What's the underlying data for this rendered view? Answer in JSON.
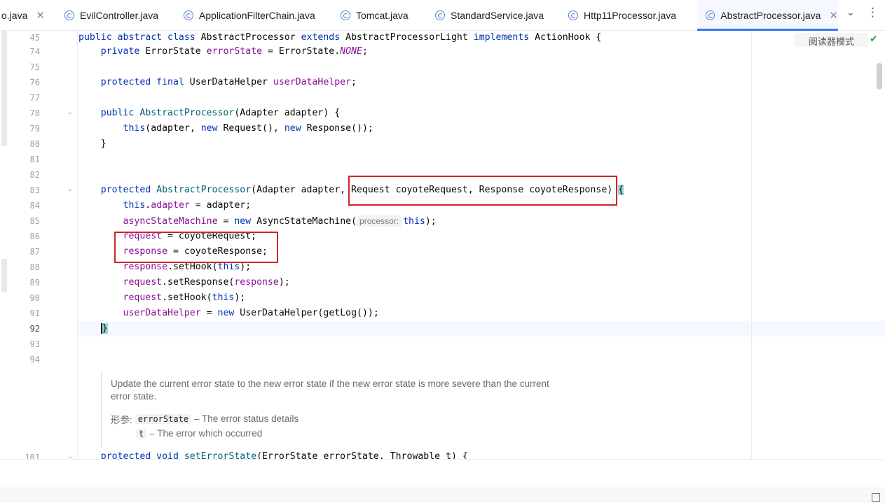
{
  "tabs": [
    {
      "label": "o.java",
      "active": false,
      "has_icon": false,
      "closable": true
    },
    {
      "label": "EvilController.java",
      "active": false,
      "has_icon": true
    },
    {
      "label": "ApplicationFilterChain.java",
      "active": false,
      "has_icon": true
    },
    {
      "label": "Tomcat.java",
      "active": false,
      "has_icon": true
    },
    {
      "label": "StandardService.java",
      "active": false,
      "has_icon": true
    },
    {
      "label": "Http11Processor.java",
      "active": false,
      "has_icon": true
    },
    {
      "label": "AbstractProcessor.java",
      "active": true,
      "has_icon": true,
      "closable": true
    }
  ],
  "toolbar": {
    "reader_mode": "阅读器模式",
    "tab_list_glyph": "⌄",
    "menu_glyph": "⋮",
    "close_glyph": "✕",
    "check_glyph": "✔"
  },
  "gutter": {
    "line_numbers": [
      "45",
      "74",
      "75",
      "76",
      "77",
      "78",
      "79",
      "80",
      "81",
      "82",
      "83",
      "84",
      "85",
      "86",
      "87",
      "88",
      "89",
      "90",
      "91",
      "92",
      "93",
      "94",
      "101"
    ],
    "current_line": "92",
    "fold_glyph": "⌄"
  },
  "code": {
    "l45": {
      "t1": "public abstract class ",
      "t2": "AbstractProcessor ",
      "t3": "extends ",
      "t4": "AbstractProcessorLight ",
      "t5": "implements ",
      "t6": "ActionHook {"
    },
    "l74": {
      "t1": "    private ",
      "t2": "ErrorState ",
      "t3": "errorState",
      "t4": " = ErrorState.",
      "t5": "NONE",
      "t6": ";"
    },
    "l76": {
      "t1": "    protected final ",
      "t2": "UserDataHelper ",
      "t3": "userDataHelper",
      "t4": ";"
    },
    "l78": {
      "t1": "    public ",
      "t2": "AbstractProcessor",
      "t3": "(Adapter adapter) {"
    },
    "l79": {
      "t1": "        ",
      "t2": "this",
      "t3": "(adapter, ",
      "t4": "new ",
      "t5": "Request(), ",
      "t6": "new ",
      "t7": "Response());"
    },
    "l80": {
      "t1": "    }"
    },
    "l83": {
      "t1": "    protected ",
      "t2": "AbstractProcessor",
      "t3": "(Adapter adapter, Request coyoteRequest, Response coyoteResponse) ",
      "t4": "{"
    },
    "l84": {
      "t1": "        ",
      "t2": "this",
      "t3": ".",
      "t4": "adapter",
      "t5": " = adapter;"
    },
    "l85": {
      "t1": "        ",
      "t2": "asyncStateMachine",
      "t3": " = ",
      "t4": "new ",
      "t5": "AsyncStateMachine(",
      "hint": "processor:",
      "t6": "this",
      "t7": ");"
    },
    "l86": {
      "t1": "        ",
      "t2": "request",
      "t3": " = coyoteRequest;"
    },
    "l87": {
      "t1": "        ",
      "t2": "response",
      "t3": " = coyoteResponse;"
    },
    "l88": {
      "t1": "        ",
      "t2": "response",
      "t3": ".setHook(",
      "t4": "this",
      "t5": ");"
    },
    "l89": {
      "t1": "        ",
      "t2": "request",
      "t3": ".setResponse(",
      "t4": "response",
      "t5": ");"
    },
    "l90": {
      "t1": "        ",
      "t2": "request",
      "t3": ".setHook(",
      "t4": "this",
      "t5": ");"
    },
    "l91": {
      "t1": "        ",
      "t2": "userDataHelper",
      "t3": " = ",
      "t4": "new ",
      "t5": "UserDataHelper(getLog());"
    },
    "l92": {
      "t1": "    ",
      "t2": "}"
    },
    "l101": {
      "t1": "    protected void ",
      "t2": "setErrorState",
      "t3": "(ErrorState errorState, Throwable t) {"
    }
  },
  "doc": {
    "description": "Update the current error state to the new error state if the new error state is more severe than the current error state.",
    "params_label": "形参:",
    "params": [
      {
        "name": "errorState",
        "desc": "– The error status details"
      },
      {
        "name": "t",
        "desc": "– The error which occurred"
      }
    ]
  }
}
